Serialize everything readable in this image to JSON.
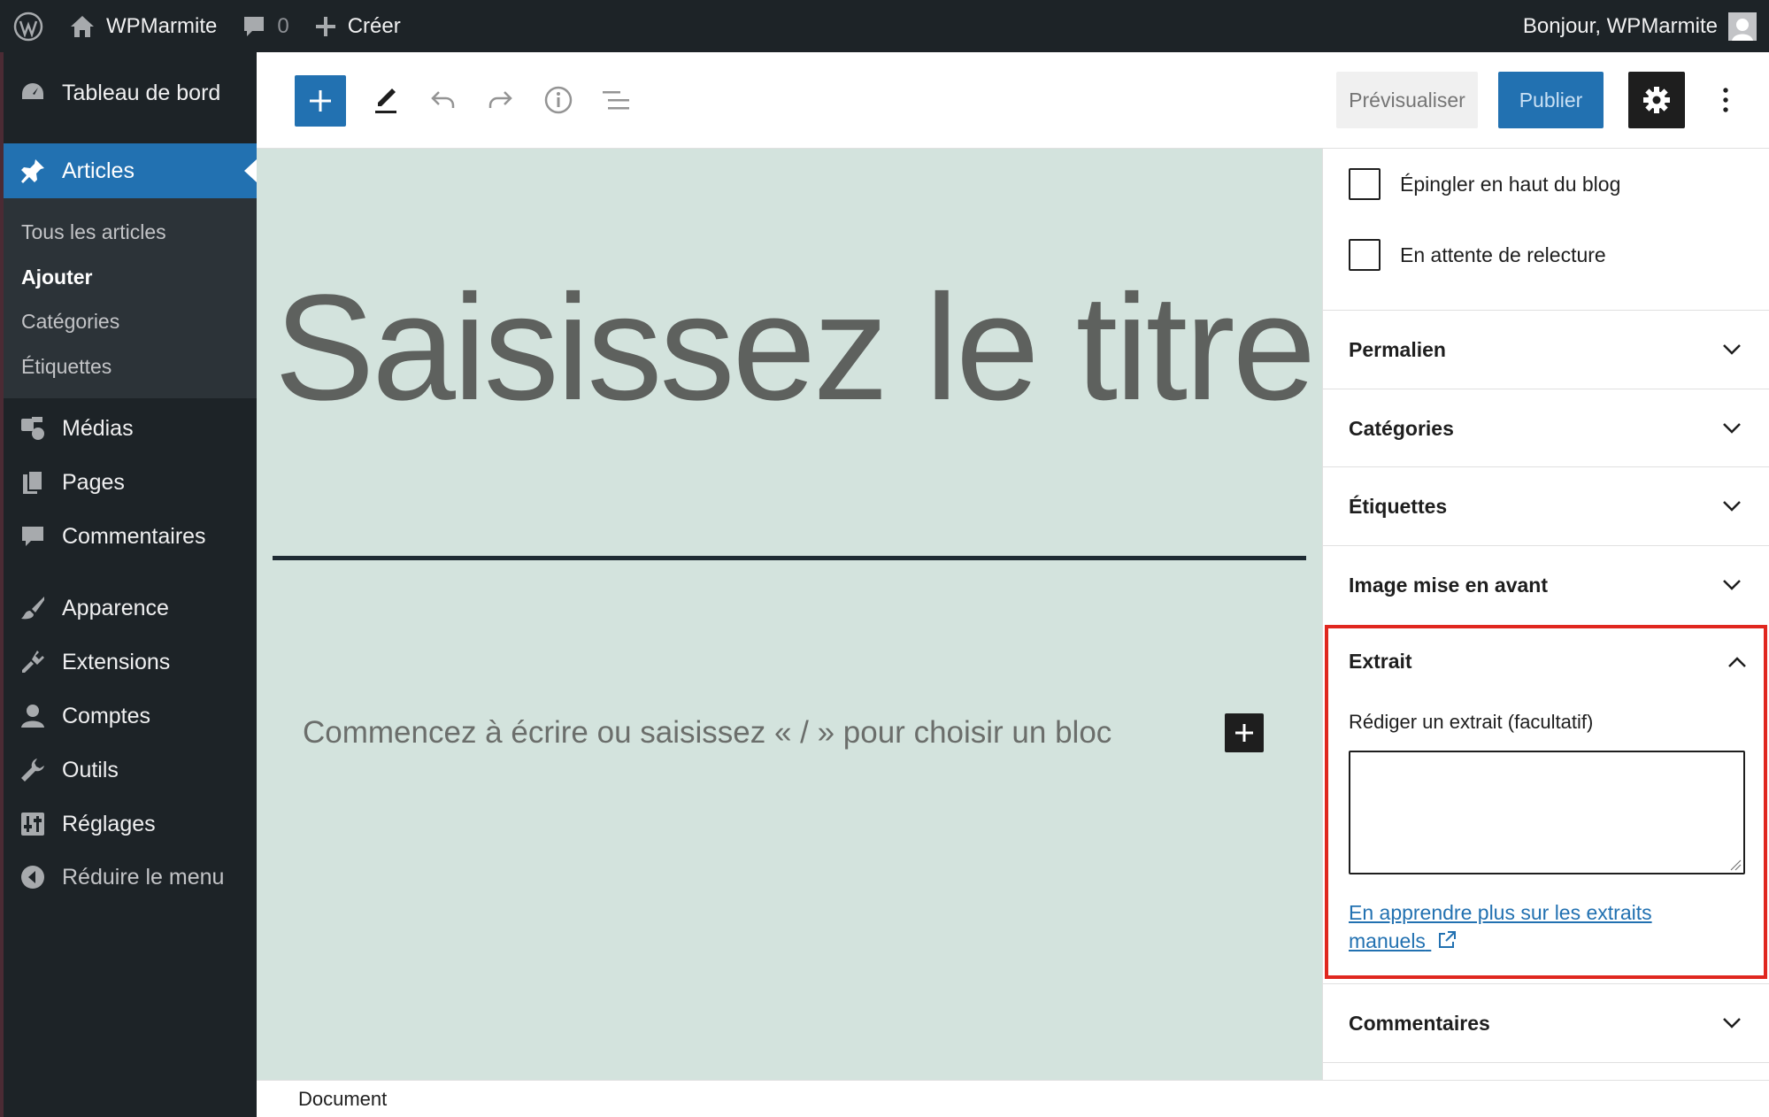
{
  "admin_bar": {
    "site_name": "WPMarmite",
    "comments_count": "0",
    "new_label": "Créer",
    "greeting": "Bonjour, WPMarmite"
  },
  "menu": {
    "dashboard": "Tableau de bord",
    "articles": "Articles",
    "sub": {
      "all": "Tous les articles",
      "add": "Ajouter",
      "categories": "Catégories",
      "tags": "Étiquettes"
    },
    "media": "Médias",
    "pages": "Pages",
    "comments": "Commentaires",
    "appearance": "Apparence",
    "plugins": "Extensions",
    "users": "Comptes",
    "tools": "Outils",
    "settings": "Réglages",
    "collapse": "Réduire le menu"
  },
  "header": {
    "preview_label": "Prévisualiser",
    "publish_label": "Publier"
  },
  "editor": {
    "title_placeholder": "Saisissez le titre",
    "body_placeholder": "Commencez à écrire ou saisissez « / » pour choisir un bloc"
  },
  "sidebar": {
    "sticky_label": "Épingler en haut du blog",
    "pending_label": "En attente de relecture",
    "panels": {
      "permalink": "Permalien",
      "categories": "Catégories",
      "tags": "Étiquettes",
      "featured_image": "Image mise en avant",
      "excerpt": "Extrait",
      "comments": "Commentaires"
    },
    "excerpt": {
      "field_label": "Rédiger un extrait (facultatif)",
      "value": "",
      "help_link": "En apprendre plus sur les extraits manuels"
    }
  },
  "footer": {
    "breadcrumb": "Document"
  },
  "colors": {
    "accent": "#2271b1",
    "admin_bg": "#1d2327",
    "canvas_bg": "#d3e3dd",
    "highlight": "#e0271f"
  }
}
